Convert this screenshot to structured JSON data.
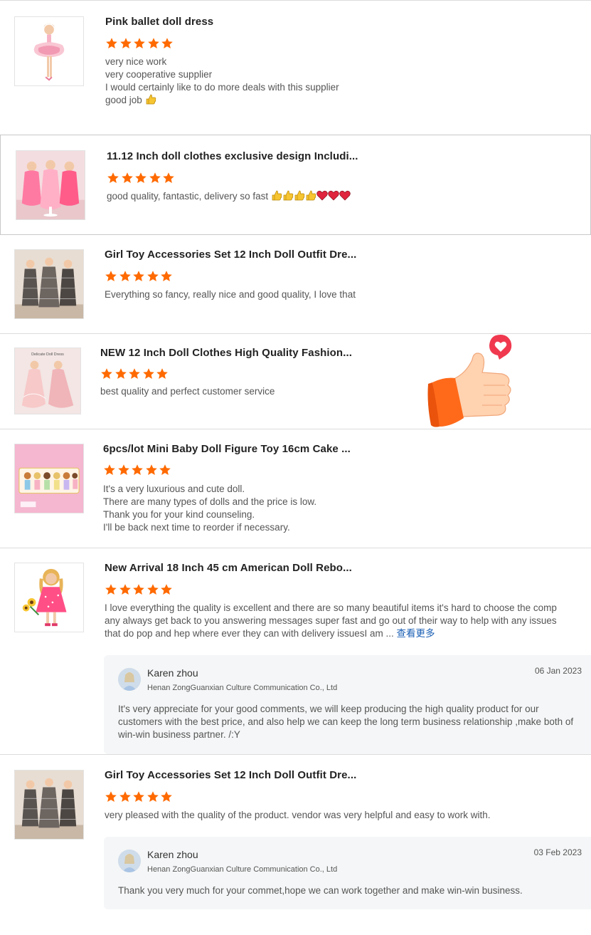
{
  "accent": "#ff6a00",
  "reviews": [
    {
      "title": "Pink ballet doll dress",
      "rating": 5,
      "lines": [
        "very nice work",
        "very cooperative supplier",
        "I would certainly like to do more deals with this supplier",
        "good job"
      ]
    },
    {
      "title": "11.12 Inch doll clothes exclusive design Includi...",
      "rating": 5,
      "lines": [
        "good quality, fantastic, delivery so fast"
      ]
    },
    {
      "title": "Girl Toy Accessories Set 12 Inch Doll Outfit Dre...",
      "rating": 5,
      "lines": [
        "Everything so fancy, really nice and good quality, I love that"
      ]
    },
    {
      "title": "NEW 12 Inch Doll Clothes High Quality Fashion...",
      "rating": 5,
      "lines": [
        "best quality and perfect customer service"
      ],
      "thumb_caption": "Delicate Doll Dress"
    },
    {
      "title": "6pcs/lot Mini Baby Doll Figure Toy 16cm Cake ...",
      "rating": 5,
      "lines": [
        "It's a very luxurious and cute doll.",
        "There are many types of dolls and the price is low.",
        "Thank you for your kind counseling.",
        "I'll be back next time to reorder if necessary."
      ]
    },
    {
      "title": "New Arrival 18 Inch 45 cm American Doll Rebo...",
      "rating": 5,
      "lines": [
        "I love everything the quality is excellent and there are so many beautiful items it's hard to choose the comp",
        "any always get back to you answering messages super fast and go out of their way to help with any issues",
        "that do pop and hep where ever they can with delivery issuesI am ..."
      ],
      "see_more": "查看更多",
      "reply": {
        "name": "Karen zhou",
        "company": "Henan ZongGuanxian Culture Communication Co., Ltd",
        "date": "06 Jan 2023",
        "lines": [
          "It's very appreciate for your good comments, we will keep producing the high quality product for our",
          "customers with the best price, and also help we can keep the long term business relationship ,make both of",
          "win-win business partner. /:Y"
        ]
      }
    },
    {
      "title": "Girl Toy Accessories Set 12 Inch Doll Outfit Dre...",
      "rating": 5,
      "lines": [
        "very pleased with the quality of the product.  vendor was very helpful and easy to work with."
      ],
      "reply": {
        "name": "Karen zhou",
        "company": "Henan ZongGuanxian Culture Communication Co., Ltd",
        "date": "03 Feb 2023",
        "lines": [
          "Thank you very much for your commet,hope we can work together and make win-win business."
        ]
      }
    }
  ]
}
